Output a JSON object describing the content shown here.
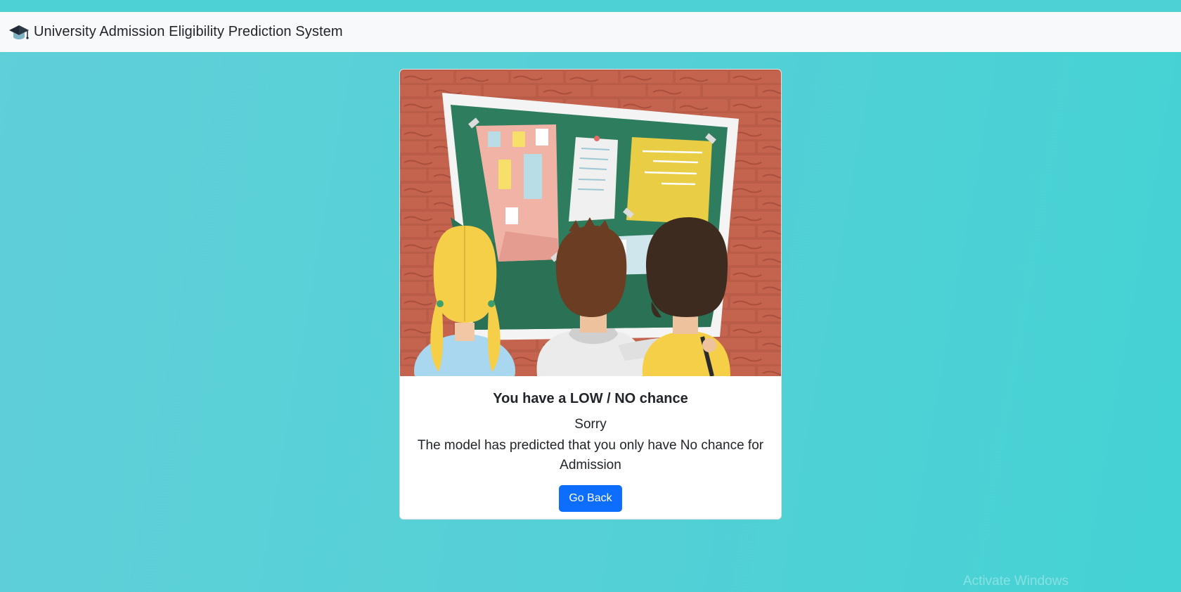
{
  "navbar": {
    "brand_icon": "graduation-cap-icon",
    "brand_text": "University Admission Eligibility Prediction System"
  },
  "result_card": {
    "image": "students-looking-at-notice-board-illustration",
    "title": "You have a LOW / NO chance",
    "subtitle": "Sorry",
    "message": "The model has predicted that you only have No chance for Admission",
    "button_label": "Go Back"
  },
  "os_watermark": "Activate Windows",
  "colors": {
    "background": "#4dd1d4",
    "navbar": "#f8f9fa",
    "primary_button": "#0d6efd",
    "brick": "#b95c48",
    "board": "#2f7d5f"
  }
}
